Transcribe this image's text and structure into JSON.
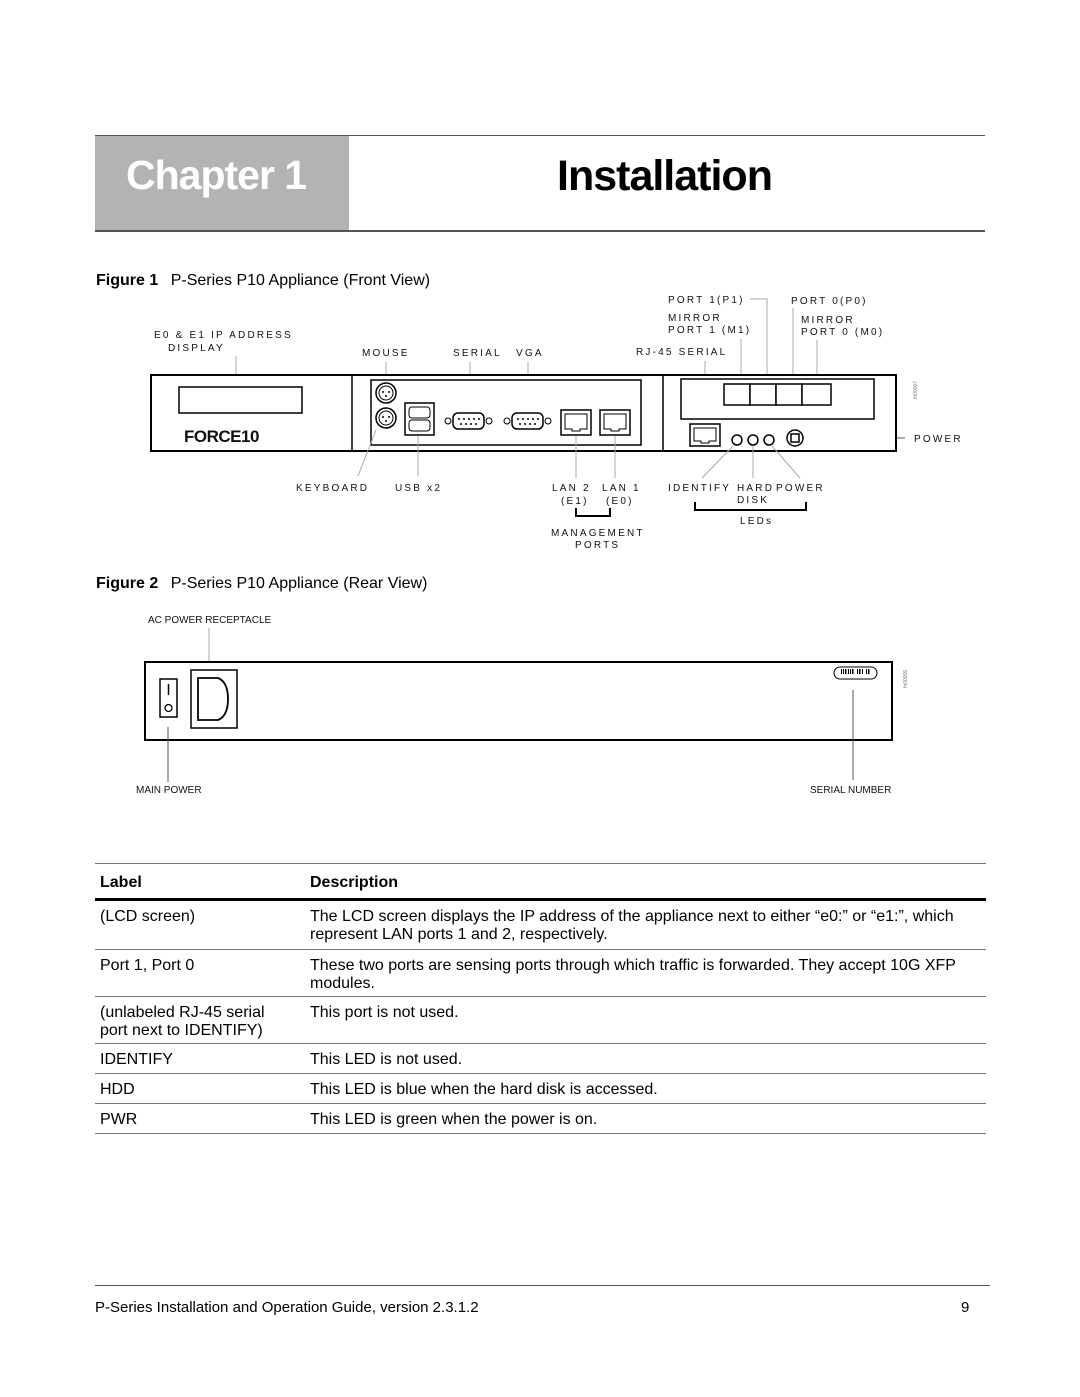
{
  "chapter": {
    "label": "Chapter 1",
    "title": "Installation"
  },
  "figure1": {
    "number": "Figure 1",
    "title": "P-Series P10 Appliance (Front View)",
    "logo": "FORCE10",
    "callouts": {
      "ip_display_1": "E0 & E1 IP ADDRESS",
      "ip_display_2": "DISPLAY",
      "mouse": "MOUSE",
      "serial": "SERIAL",
      "vga": "VGA",
      "port1": "PORT 1(P1)",
      "port0": "PORT 0(P0)",
      "mirror1_a": "MIRROR",
      "mirror1_b": "PORT 1 (M1)",
      "mirror0_a": "MIRROR",
      "mirror0_b": "PORT 0 (M0)",
      "rj45": "RJ-45 SERIAL",
      "power": "POWER",
      "keyboard": "KEYBOARD",
      "usb": "USB x2",
      "lan2_a": "LAN 2",
      "lan2_b": "(E1)",
      "lan1_a": "LAN 1",
      "lan1_b": "(E0)",
      "mgmt_a": "MANAGEMENT",
      "mgmt_b": "PORTS",
      "identify": "IDENTIFY",
      "hard_disk_a": "HARD",
      "hard_disk_b": "DISK",
      "power_led": "POWER",
      "leds": "LEDs"
    }
  },
  "figure2": {
    "number": "Figure 2",
    "title": "P-Series P10 Appliance (Rear View)",
    "callouts": {
      "ac_power": "AC POWER RECEPTACLE",
      "main_power": "MAIN POWER",
      "serial_number": "SERIAL NUMBER"
    }
  },
  "table": {
    "headers": [
      "Label",
      "Description"
    ],
    "rows": [
      {
        "label": "(LCD screen)",
        "description": "The LCD screen displays the IP address of the appliance next to either “e0:” or “e1:”, which represent LAN ports 1 and 2, respectively."
      },
      {
        "label": "Port 1, Port 0",
        "description": "These two ports are sensing ports through which traffic is forwarded. They accept 10G XFP modules."
      },
      {
        "label": "(unlabeled RJ-45 serial port next to IDENTIFY)",
        "description": "This port is not used."
      },
      {
        "label": "IDENTIFY",
        "description": "This LED is not used."
      },
      {
        "label": "HDD",
        "description": "This LED is blue when the hard disk is accessed."
      },
      {
        "label": "PWR",
        "description": "This LED is green when the power is on."
      }
    ]
  },
  "footer": {
    "text": "P-Series Installation and Operation Guide, version 2.3.1.2",
    "page": "9"
  }
}
